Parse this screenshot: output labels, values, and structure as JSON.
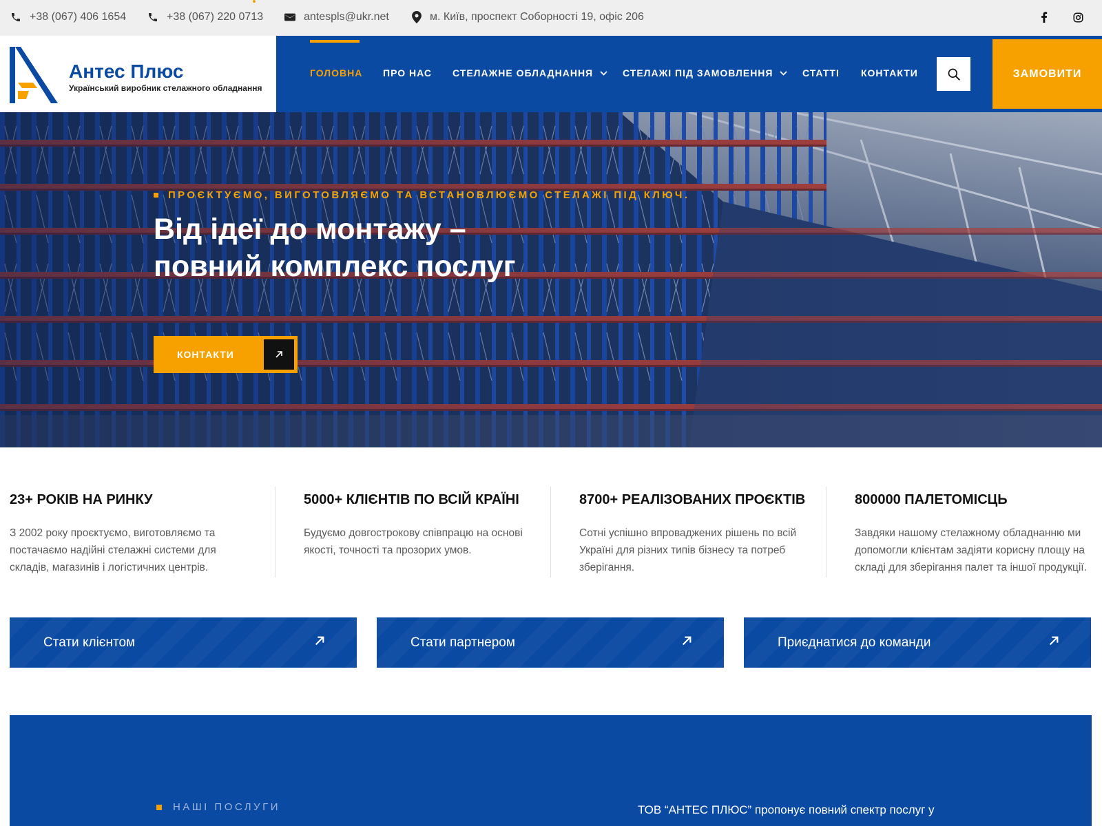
{
  "topbar": {
    "phone1": "+38 (067) 406 1654",
    "phone2": "+38 (067) 220 0713",
    "email": "antespls@ukr.net",
    "address": "м. Київ, проспект Соборності 19, офіс 206",
    "icons": [
      "phone-icon",
      "phone-icon",
      "mail-icon",
      "map-pin-icon",
      "facebook-icon",
      "instagram-icon"
    ]
  },
  "header": {
    "logo_title": "Антес Плюс",
    "logo_subtitle": "Український виробник стелажного обладнання",
    "nav": [
      {
        "label": "ГОЛОВНА",
        "active": true
      },
      {
        "label": "ПРО НАС"
      },
      {
        "label": "СТЕЛАЖНЕ ОБЛАДНАННЯ",
        "has_dropdown": true
      },
      {
        "label": "СТЕЛАЖІ ПІД ЗАМОВЛЕННЯ",
        "has_dropdown": true
      },
      {
        "label": "СТАТТІ"
      },
      {
        "label": "КОНТАКТИ"
      }
    ],
    "order_label": "ЗАМОВИТИ"
  },
  "hero": {
    "kicker": "ПРОЄКТУЄМО, ВИГОТОВЛЯЄМО ТА ВСТАНОВЛЮЄМО СТЕЛАЖІ ПІД КЛЮЧ.",
    "title_line1": "Від ідеї до монтажу –",
    "title_line2": "повний комплекс послуг",
    "button_label": "КОНТАКТИ"
  },
  "stats": [
    {
      "title": "23+ РОКІВ НА РИНКУ",
      "lines": [
        "З 2002 року проєктуємо, виготовляємо та",
        "постачаємо надійні стелажні системи для",
        "складів, магазинів і логістичних центрів."
      ]
    },
    {
      "title": "5000+ КЛІЄНТІВ ПО ВСІЙ КРАЇНІ",
      "lines": [
        "Будуємо довгострокову співпрацю на основі",
        "якості, точності та прозорих умов."
      ]
    },
    {
      "title": "8700+ РЕАЛІЗОВАНИХ ПРОЄКТІВ",
      "lines": [
        "Сотні успішно впроваджених рішень по всій",
        "Україні для різних типів бізнесу та потреб",
        "зберігання."
      ]
    },
    {
      "title": "800000 ПАЛЕТОМІСЦЬ",
      "lines": [
        "Завдяки нашому стелажному обладнанню ми",
        "допомогли клієнтам задіяти корисну площу на",
        "складі для зберігання палет та іншої продукції."
      ]
    }
  ],
  "ctas": [
    "Стати клієнтом",
    "Стати партнером",
    "Приєднатися до команди"
  ],
  "services": {
    "kicker": "НАШІ ПОСЛУГИ",
    "text": "ТОВ “АНТЕС ПЛЮС” пропонує повний спектр послуг у"
  },
  "colors": {
    "brand_blue": "#0a4aa3",
    "accent_orange": "#f7a100"
  }
}
